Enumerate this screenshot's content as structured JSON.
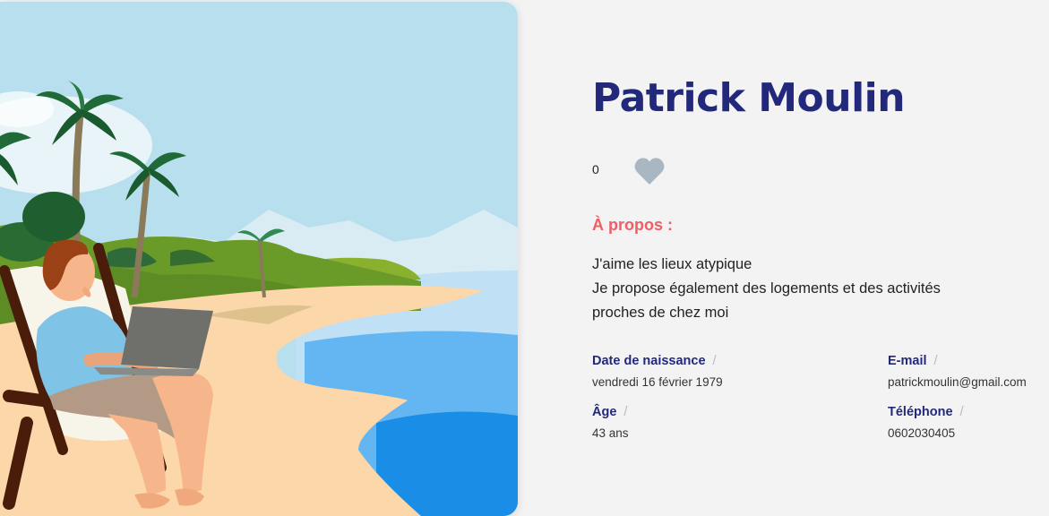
{
  "profile": {
    "name": "Patrick Moulin",
    "likes": "0",
    "about_title": "À propos :",
    "about_lines": [
      "J'aime les lieux atypique",
      "Je propose également des logements et des activités",
      "proches de chez moi"
    ],
    "separator": "/",
    "details": {
      "birthdate": {
        "label": "Date de naissance",
        "value": "vendredi 16 février 1979"
      },
      "age": {
        "label": "Âge",
        "value": "43 ans"
      },
      "email": {
        "label": "E-mail",
        "value": "patrickmoulin@gmail.com"
      },
      "phone": {
        "label": "Téléphone",
        "value": "0602030405"
      }
    }
  },
  "colors": {
    "title": "#23297a",
    "accent": "#ef5d65",
    "heart": "#a9b7c3",
    "background": "#f3f3f4"
  },
  "icons": {
    "like": "heart-icon"
  }
}
